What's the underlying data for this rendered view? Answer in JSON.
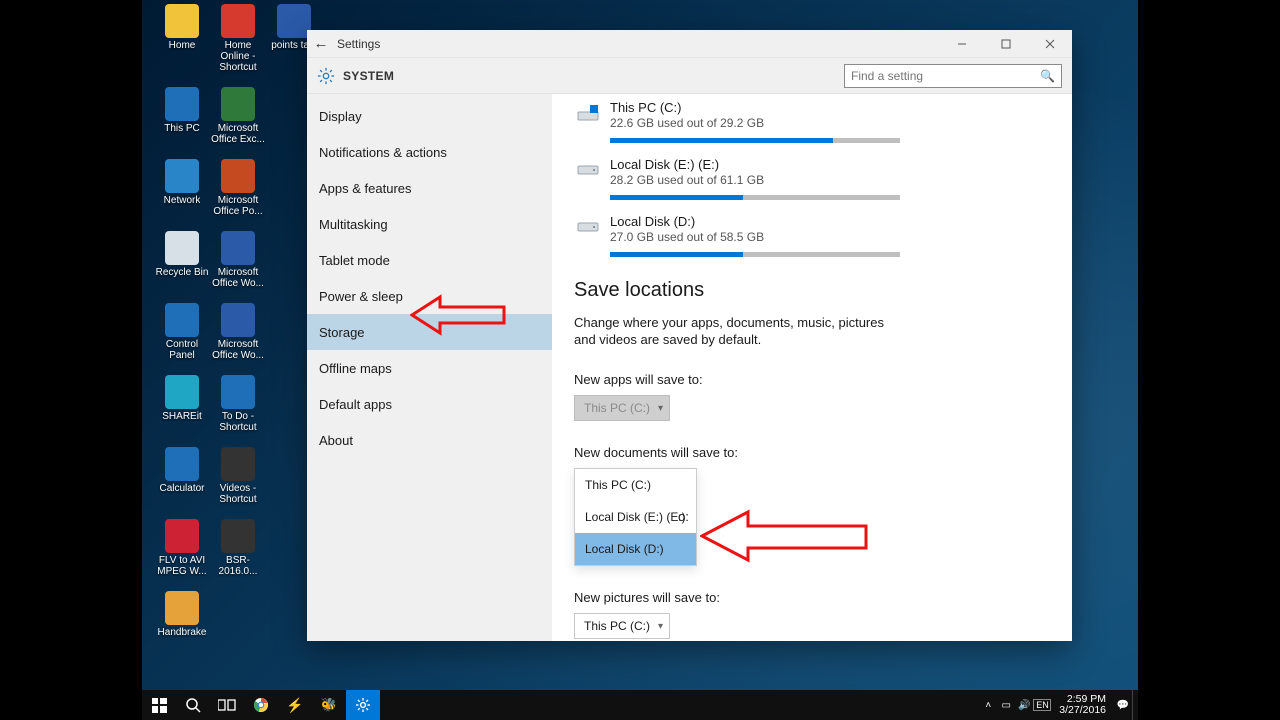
{
  "desktop_icons": [
    {
      "label": "Home",
      "color": "#f1c33b"
    },
    {
      "label": "Home Online - Shortcut",
      "color": "#d63a2e"
    },
    {
      "label": "points tabl",
      "color": "#2a5aa8"
    },
    {
      "label": "This PC",
      "color": "#1e6fb8"
    },
    {
      "label": "Microsoft Office Exc...",
      "color": "#2f7a3a"
    },
    {
      "label": "",
      "color": "transparent"
    },
    {
      "label": "Network",
      "color": "#2a84c8"
    },
    {
      "label": "Microsoft Office Po...",
      "color": "#c54a1f"
    },
    {
      "label": "",
      "color": "transparent"
    },
    {
      "label": "Recycle Bin",
      "color": "#d7e0e6"
    },
    {
      "label": "Microsoft Office Wo...",
      "color": "#2a5aa8"
    },
    {
      "label": "",
      "color": "transparent"
    },
    {
      "label": "Control Panel",
      "color": "#1e6fb8"
    },
    {
      "label": "Microsoft Office Wo...",
      "color": "#2a5aa8"
    },
    {
      "label": "",
      "color": "transparent"
    },
    {
      "label": "SHAREit",
      "color": "#1fa6c4"
    },
    {
      "label": "To Do - Shortcut",
      "color": "#1e6fb8"
    },
    {
      "label": "",
      "color": "transparent"
    },
    {
      "label": "Calculator",
      "color": "#1e6fb8"
    },
    {
      "label": "Videos - Shortcut",
      "color": "#333"
    },
    {
      "label": "",
      "color": "transparent"
    },
    {
      "label": "FLV to AVI MPEG W...",
      "color": "#c23"
    },
    {
      "label": "BSR-2016.0...",
      "color": "#333"
    },
    {
      "label": "",
      "color": "transparent"
    },
    {
      "label": "Handbrake",
      "color": "#e5a13a"
    }
  ],
  "window": {
    "title": "Settings",
    "header": "SYSTEM",
    "search_placeholder": "Find a setting"
  },
  "sidebar": {
    "items": [
      {
        "label": "Display"
      },
      {
        "label": "Notifications & actions"
      },
      {
        "label": "Apps & features"
      },
      {
        "label": "Multitasking"
      },
      {
        "label": "Tablet mode"
      },
      {
        "label": "Power & sleep"
      },
      {
        "label": "Storage",
        "selected": true
      },
      {
        "label": "Offline maps"
      },
      {
        "label": "Default apps"
      },
      {
        "label": "About"
      }
    ]
  },
  "drives": [
    {
      "name": "This PC (C:)",
      "used": "22.6 GB used out of 29.2 GB",
      "pct": 77
    },
    {
      "name": "Local Disk (E:) (E:)",
      "used": "28.2 GB used out of 61.1 GB",
      "pct": 46
    },
    {
      "name": "Local Disk (D:)",
      "used": "27.0 GB used out of 58.5 GB",
      "pct": 46
    }
  ],
  "save_locations": {
    "title": "Save locations",
    "subtitle": "Change where your apps, documents, music, pictures and videos are saved by default.",
    "apps_label": "New apps will save to:",
    "apps_value": "This PC (C:)",
    "docs_label": "New documents will save to:",
    "docs_trailing": "o:",
    "docs_options": [
      {
        "label": "This PC (C:)"
      },
      {
        "label": "Local Disk (E:) (E:)"
      },
      {
        "label": "Local Disk (D:)",
        "highlight": true
      }
    ],
    "pics_label": "New pictures will save to:",
    "pics_value": "This PC (C:)"
  },
  "taskbar": {
    "time": "2:59 PM",
    "date": "3/27/2016"
  }
}
